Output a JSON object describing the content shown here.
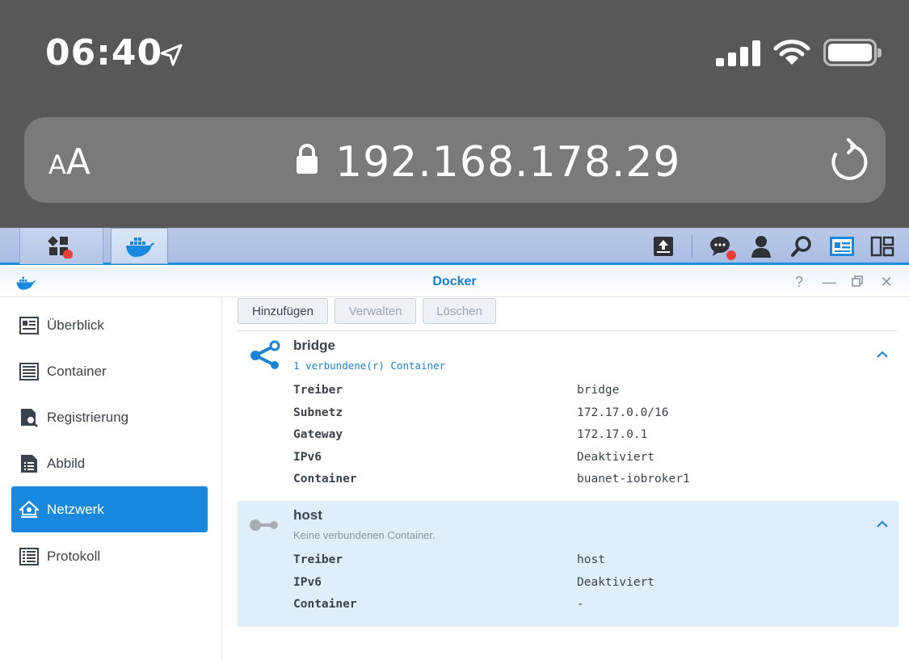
{
  "ios": {
    "time": "06:40",
    "text_size_small": "A",
    "text_size_big": "A",
    "url": "192.168.178.29"
  },
  "window": {
    "title": "Docker"
  },
  "sidebar": {
    "items": [
      {
        "label": "Überblick",
        "icon": "overview-icon"
      },
      {
        "label": "Container",
        "icon": "container-icon"
      },
      {
        "label": "Registrierung",
        "icon": "registry-icon"
      },
      {
        "label": "Abbild",
        "icon": "image-icon"
      },
      {
        "label": "Netzwerk",
        "icon": "network-icon",
        "active": true
      },
      {
        "label": "Protokoll",
        "icon": "log-icon"
      }
    ]
  },
  "toolbar": {
    "add_label": "Hinzufügen",
    "manage_label": "Verwalten",
    "delete_label": "Löschen"
  },
  "networks": [
    {
      "name": "bridge",
      "subtitle": "1 verbundene(r) Container",
      "rows": [
        {
          "key": "Treiber",
          "value": "bridge"
        },
        {
          "key": "Subnetz",
          "value": "172.17.0.0/16"
        },
        {
          "key": "Gateway",
          "value": "172.17.0.1"
        },
        {
          "key": "IPv6",
          "value": "Deaktiviert"
        },
        {
          "key": "Container",
          "value": "buanet-iobroker1"
        }
      ]
    },
    {
      "name": "host",
      "subtitle": "Keine verbundenen Container.",
      "rows": [
        {
          "key": "Treiber",
          "value": "host"
        },
        {
          "key": "IPv6",
          "value": "Deaktiviert"
        },
        {
          "key": "Container",
          "value": "-"
        }
      ]
    }
  ],
  "colors": {
    "accent": "#1b88e0",
    "title_blue": "#1a80d0",
    "host_bg": "#dfeefa",
    "ios_bg": "#585858"
  }
}
